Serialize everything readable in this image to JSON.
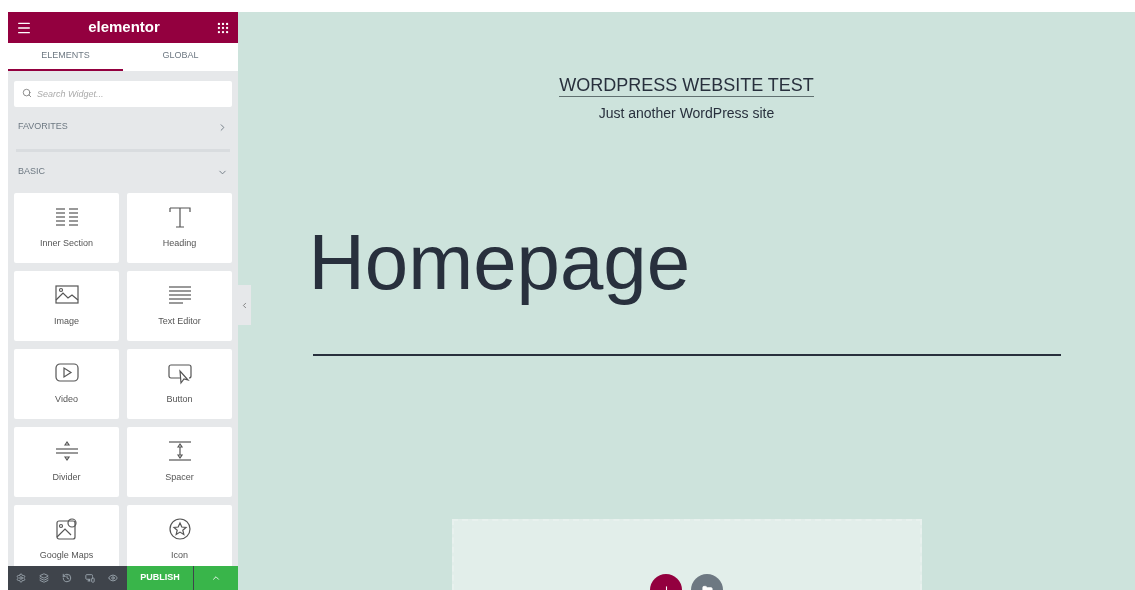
{
  "panel": {
    "logo": "elementor",
    "tabs": [
      {
        "label": "ELEMENTS",
        "selected": true
      },
      {
        "label": "GLOBAL",
        "selected": false
      }
    ],
    "search": {
      "placeholder": "Search Widget..."
    },
    "categories": [
      {
        "label": "FAVORITES",
        "expanded": false
      },
      {
        "label": "BASIC",
        "expanded": true
      }
    ],
    "widgets": [
      {
        "label": "Inner Section"
      },
      {
        "label": "Heading"
      },
      {
        "label": "Image"
      },
      {
        "label": "Text Editor"
      },
      {
        "label": "Video"
      },
      {
        "label": "Button"
      },
      {
        "label": "Divider"
      },
      {
        "label": "Spacer"
      },
      {
        "label": "Google Maps"
      },
      {
        "label": "Icon"
      }
    ],
    "footer": {
      "publish": "PUBLISH"
    }
  },
  "canvas": {
    "site_title": "WORDPRESS WEBSITE TEST",
    "tagline": "Just another WordPress site",
    "page_title": "Homepage"
  }
}
